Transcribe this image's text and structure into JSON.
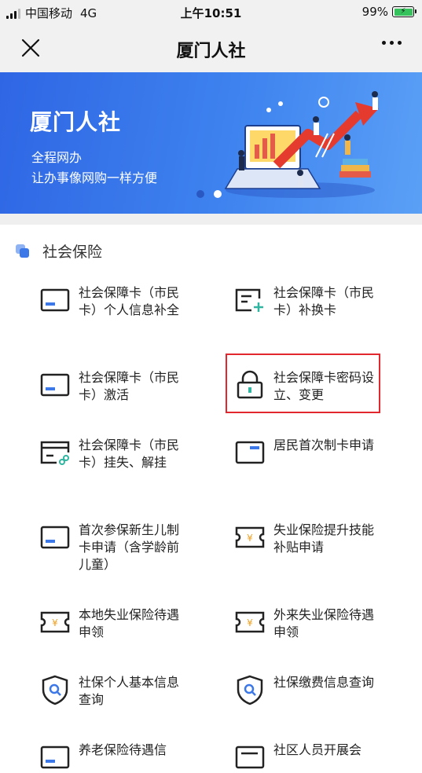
{
  "status": {
    "carrier": "中国移动",
    "network": "4G",
    "time": "上午10:51",
    "battery": "99%"
  },
  "nav": {
    "title": "厦门人社",
    "close_icon": "close-icon",
    "more_icon": "more-icon"
  },
  "banner": {
    "title": "厦门人社",
    "subtitle1": "全程网办",
    "subtitle2": "让办事像网购一样方便",
    "dots": 2,
    "active_dot": 2
  },
  "section": {
    "title": "社会保险"
  },
  "services": [
    {
      "label": "社会保障卡（市民卡）个人信息补全",
      "icon": "card-icon"
    },
    {
      "label": "社会保障卡（市民卡）补换卡",
      "icon": "card-add-icon"
    },
    {
      "label": "社会保障卡（市民卡）激活",
      "icon": "card-icon"
    },
    {
      "label": "社会保障卡密码设立、变更",
      "icon": "lock-icon"
    },
    {
      "label": "社会保障卡（市民卡）挂失、解挂",
      "icon": "card-link-icon"
    },
    {
      "label": "居民首次制卡申请",
      "icon": "card-icon"
    },
    {
      "label": "首次参保新生儿制卡申请（含学龄前儿童）",
      "icon": "card-icon"
    },
    {
      "label": "失业保险提升技能补贴申请",
      "icon": "ticket-icon"
    },
    {
      "label": "本地失业保险待遇申领",
      "icon": "ticket-icon"
    },
    {
      "label": "外来失业保险待遇申领",
      "icon": "ticket-icon"
    },
    {
      "label": "社保个人基本信息查询",
      "icon": "shield-search-icon"
    },
    {
      "label": "社保缴费信息查询",
      "icon": "shield-search-icon"
    },
    {
      "label": "养老保险待遇信",
      "icon": "card-icon"
    },
    {
      "label": "社区人员开展会",
      "icon": "card-icon"
    }
  ],
  "colors": {
    "accent": "#3c78e8",
    "highlight": "#e2282e",
    "icon_accent": "#2fb5a0"
  }
}
